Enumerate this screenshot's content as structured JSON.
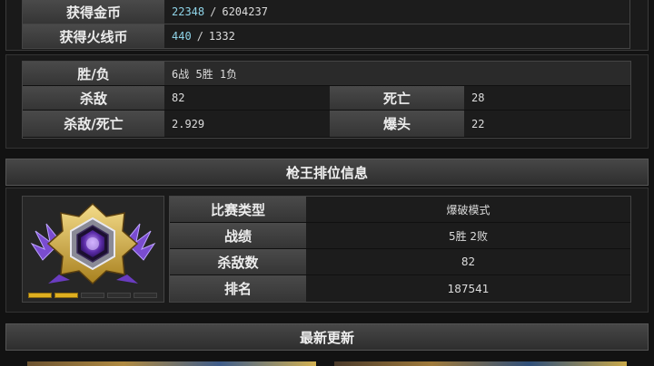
{
  "rewards": {
    "gold": {
      "label": "获得金币",
      "value": "22348",
      "total": "6204237"
    },
    "fire": {
      "label": "获得火线币",
      "value": "440",
      "total": "1332"
    },
    "separator": "/"
  },
  "combat": {
    "win_loss": {
      "label": "胜/负",
      "value": "6战 5胜 1负"
    },
    "kills": {
      "label": "杀敌",
      "value": "82"
    },
    "deaths": {
      "label": "死亡",
      "value": "28"
    },
    "kd": {
      "label": "杀敌/死亡",
      "value": "2.929"
    },
    "headshots": {
      "label": "爆头",
      "value": "22"
    }
  },
  "ranked": {
    "title": "枪王排位信息",
    "progress_filled": 2,
    "progress_total": 5,
    "rows": [
      {
        "label": "比赛类型",
        "value": "爆破模式"
      },
      {
        "label": "战绩",
        "value": "5胜 2败"
      },
      {
        "label": "杀敌数",
        "value": "82"
      },
      {
        "label": "排名",
        "value": "187541"
      }
    ]
  },
  "updates": {
    "title": "最新更新"
  },
  "colors": {
    "highlight": "#8fd4e8",
    "pip_active": "#e0b020",
    "pip_inactive": "#2e2e2e"
  }
}
